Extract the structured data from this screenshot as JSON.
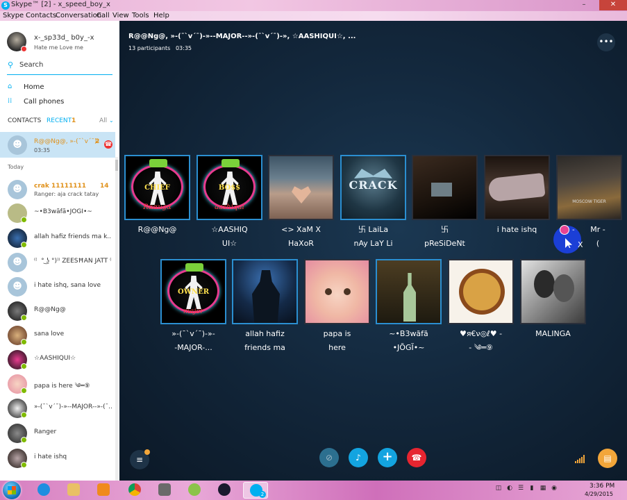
{
  "window": {
    "title": "Skype™ [2] - x_speed_boy_x",
    "controls": {
      "minimize": "–",
      "maximize": "☐",
      "close": "✕"
    }
  },
  "menu": [
    "Skype",
    "Contacts",
    "Conversation",
    "Call",
    "View",
    "Tools",
    "Help"
  ],
  "profile": {
    "name": "x-_sp33d_ b0y_-x",
    "mood": "Hate me Love me"
  },
  "search": {
    "label": "Search"
  },
  "nav": {
    "home": "Home",
    "call_phones": "Call phones"
  },
  "tabs": {
    "contacts": "CONTACTS",
    "recent": "RECENT",
    "recent_count": "1",
    "all": "All",
    "all_chevron": "⌄"
  },
  "active_conversation": {
    "name": "R@@Ng@, »-(¯`v´¯)-",
    "time": "03:35",
    "count": "2",
    "call_badge": "☎"
  },
  "today_label": "Today",
  "contacts": [
    {
      "name": "crak 11111111",
      "sub": "Ranger: aja crack tatay",
      "count": "14"
    },
    {
      "name": "~•B3wãfã•JÕGĨ•~",
      "sub": ""
    },
    {
      "name": "allah hafiz friends ma k...",
      "sub": ""
    },
    {
      "name": "⁽⁽ ͡ ͡° ͜ʖ ͡°)⁾⁾ ŹÉÉŠĦÄÑ JÄTT ⁽⁽ ͡°",
      "sub": ""
    },
    {
      "name": "i hate ishq, sana love",
      "sub": ""
    },
    {
      "name": "R@@Ng@",
      "sub": ""
    },
    {
      "name": "sana love",
      "sub": ""
    },
    {
      "name": "☆AASHIQUI☆",
      "sub": ""
    },
    {
      "name": "papa is here ༄═⑨",
      "sub": ""
    },
    {
      "name": "»-(¯`v´¯)-»--MAJOR--»-(¯...",
      "sub": ""
    },
    {
      "name": "Ranger",
      "sub": ""
    },
    {
      "name": "i hate ishq",
      "sub": ""
    }
  ],
  "conversation": {
    "title": "R@@Ng@, »-(¯`v´¯)-»--MAJOR--»-(¯`v´¯)-», ☆AASHIQUI☆, ...",
    "participants": "13 participants",
    "duration": "03:35",
    "more_label": "•••"
  },
  "participants_row1": [
    {
      "line1": "R@@Ng@",
      "line2": "",
      "poster_top": "CHIEF",
      "poster_bottom": "Rααиgα"
    },
    {
      "line1": "☆AASHIQ",
      "line2": "UI☆",
      "poster_top": "BO$$",
      "poster_bottom": "aashiqui"
    },
    {
      "line1": "<> XaM X",
      "line2": "HaXoR"
    },
    {
      "line1": "卐 LaiLa",
      "line2": "nAy LaY Li",
      "photo_text": "CRACK"
    },
    {
      "line1": "卐",
      "line2": "pReSiDeNt"
    },
    {
      "line1": "i hate ishq",
      "line2": ""
    },
    {
      "line1": "Mr -",
      "line2": "(",
      "caption": "MOSCOW TIGER",
      "mark_a": "X",
      "mark_b": "-"
    }
  ],
  "participants_row2": [
    {
      "line1": "»-(¯`v´¯)-»-",
      "line2": "-MAJOR-...",
      "poster_top": "OWNER",
      "poster_bottom": "major"
    },
    {
      "line1": "allah hafiz",
      "line2": "friends ma"
    },
    {
      "line1": "papa is",
      "line2": "here"
    },
    {
      "line1": "~•B3wãfã",
      "line2": "•JÕGĨ•~"
    },
    {
      "line1": "♥я€ν◎ℓ♥ -",
      "line2": "-   ༄═⑨"
    },
    {
      "line1": "MALINGA",
      "line2": ""
    }
  ],
  "call_controls": {
    "video": "⊘",
    "mic": "♪",
    "add": "+",
    "hangup": "☎",
    "list": "≡",
    "chat": "▤"
  },
  "taskbar": {
    "time": "3:36 PM",
    "date": "4/29/2015",
    "skype_badge": "S",
    "notification": "2",
    "tray": [
      "◫",
      "◐",
      "☰",
      "▮",
      "▦",
      "◉"
    ]
  },
  "colors": {
    "skype_blue": "#00aff0",
    "orange": "#e0911a",
    "hangup_red": "#e62530"
  }
}
